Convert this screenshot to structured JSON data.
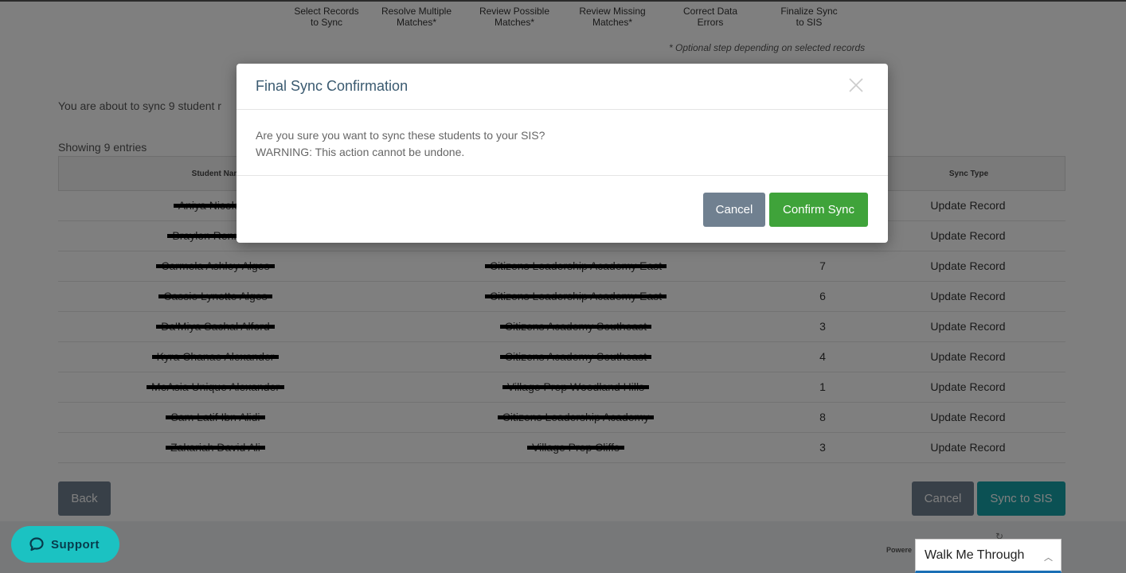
{
  "steps": [
    {
      "line1": "Select Records",
      "line2": "to Sync"
    },
    {
      "line1": "Resolve Multiple",
      "line2": "Matches*"
    },
    {
      "line1": "Review Possible",
      "line2": "Matches*"
    },
    {
      "line1": "Review Missing",
      "line2": "Matches*"
    },
    {
      "line1": "Correct Data",
      "line2": "Errors"
    },
    {
      "line1": "Finalize Sync",
      "line2": "to SIS"
    }
  ],
  "optional_note": "* Optional step depending on selected records",
  "intro_text": "You are about to sync 9 student r",
  "showing_text": "Showing 9 entries",
  "table": {
    "headers": {
      "student_name": "Student Nam",
      "sync_type": "Sync Type"
    },
    "rows": [
      {
        "name": "Aniya Nicole Al",
        "school": "",
        "grade": "",
        "sync_type": "Update Record"
      },
      {
        "name": "Braylon Rennie A",
        "school": "",
        "grade": "",
        "sync_type": "Update Record"
      },
      {
        "name": "Carmela Ashley Alges",
        "school": "Citizens Leadership Academy East",
        "grade": "7",
        "sync_type": "Update Record"
      },
      {
        "name": "Cassie Lynette Alges",
        "school": "Citizens Leadership Academy East",
        "grade": "6",
        "sync_type": "Update Record"
      },
      {
        "name": "Da'Miya Sachal Alford",
        "school": "Citizens Academy Southeast",
        "grade": "3",
        "sync_type": "Update Record"
      },
      {
        "name": "Kyra Chanae Alexander",
        "school": "Citizens Academy Southeast",
        "grade": "4",
        "sync_type": "Update Record"
      },
      {
        "name": "MeAsia Unique Alexander",
        "school": "Village Prep Woodland Hills",
        "grade": "1",
        "sync_type": "Update Record"
      },
      {
        "name": "Sam Latif Ibn Alidi",
        "school": "Citizens Leadership Academy",
        "grade": "8",
        "sync_type": "Update Record"
      },
      {
        "name": "Zakariah David Ali",
        "school": "Village Prep Cliffs",
        "grade": "3",
        "sync_type": "Update Record"
      }
    ]
  },
  "buttons": {
    "back": "Back",
    "cancel": "Cancel",
    "sync": "Sync to SIS"
  },
  "footer": {
    "powered": "Powere"
  },
  "support_label": "Support",
  "walkme_label": "Walk Me Through",
  "modal": {
    "title": "Final Sync Confirmation",
    "body_line1": "Are you sure you want to sync these students to your SIS?",
    "body_line2": "WARNING: This action cannot be undone.",
    "cancel_label": "Cancel",
    "confirm_label": "Confirm Sync"
  },
  "colors": {
    "sync_button": "#17a2a8",
    "confirm_button": "#3fa33a",
    "cancel_button": "#708090",
    "support_button": "#1bc2c2",
    "overlay": "rgba(0,0,0,0.5)"
  }
}
